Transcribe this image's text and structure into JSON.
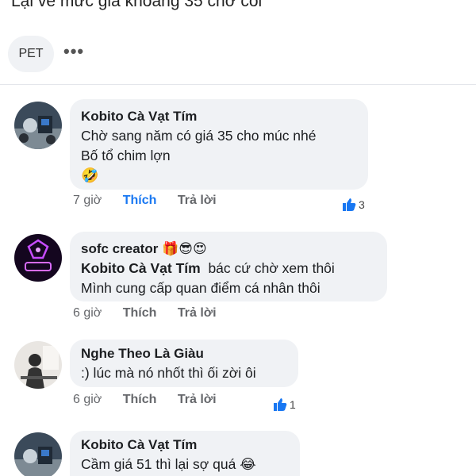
{
  "post": {
    "text": "Lại về mức giá khoảng 35 chờ cỏi",
    "tag_chip": "PET",
    "more_label": "•••"
  },
  "comments": [
    {
      "author": "Kobito Cà Vạt Tím",
      "lines": [
        "Chờ sang năm có giá 35 cho múc nhé",
        "Bố tổ chim lợn"
      ],
      "emoji": "🤣",
      "time": "7 giờ",
      "like_label": "Thích",
      "reply_label": "Trả lời",
      "reactions": "3"
    },
    {
      "author": "sofc creator",
      "author_emojis": "🎁😎😍",
      "mention": "Kobito Cà Vạt Tím",
      "lines": [
        "bác cứ chờ xem thôi",
        "Mình cung cấp quan điểm cá nhân thôi"
      ],
      "time": "6 giờ",
      "like_label": "Thích",
      "reply_label": "Trả lời"
    },
    {
      "author": "Nghe Theo Là Giàu",
      "lines": [
        ":) lúc mà nó nhốt thì ối zời ôi"
      ],
      "time": "6 giờ",
      "like_label": "Thích",
      "reply_label": "Trả lời",
      "reactions": "1"
    },
    {
      "author": "Kobito Cà Vạt Tím",
      "lines": [
        "Cầm giá 51 thì lại sợ quá 😂"
      ]
    }
  ],
  "colors": {
    "bubble": "#f0f2f5",
    "liked": "#1877f2",
    "meta": "#65676b"
  }
}
